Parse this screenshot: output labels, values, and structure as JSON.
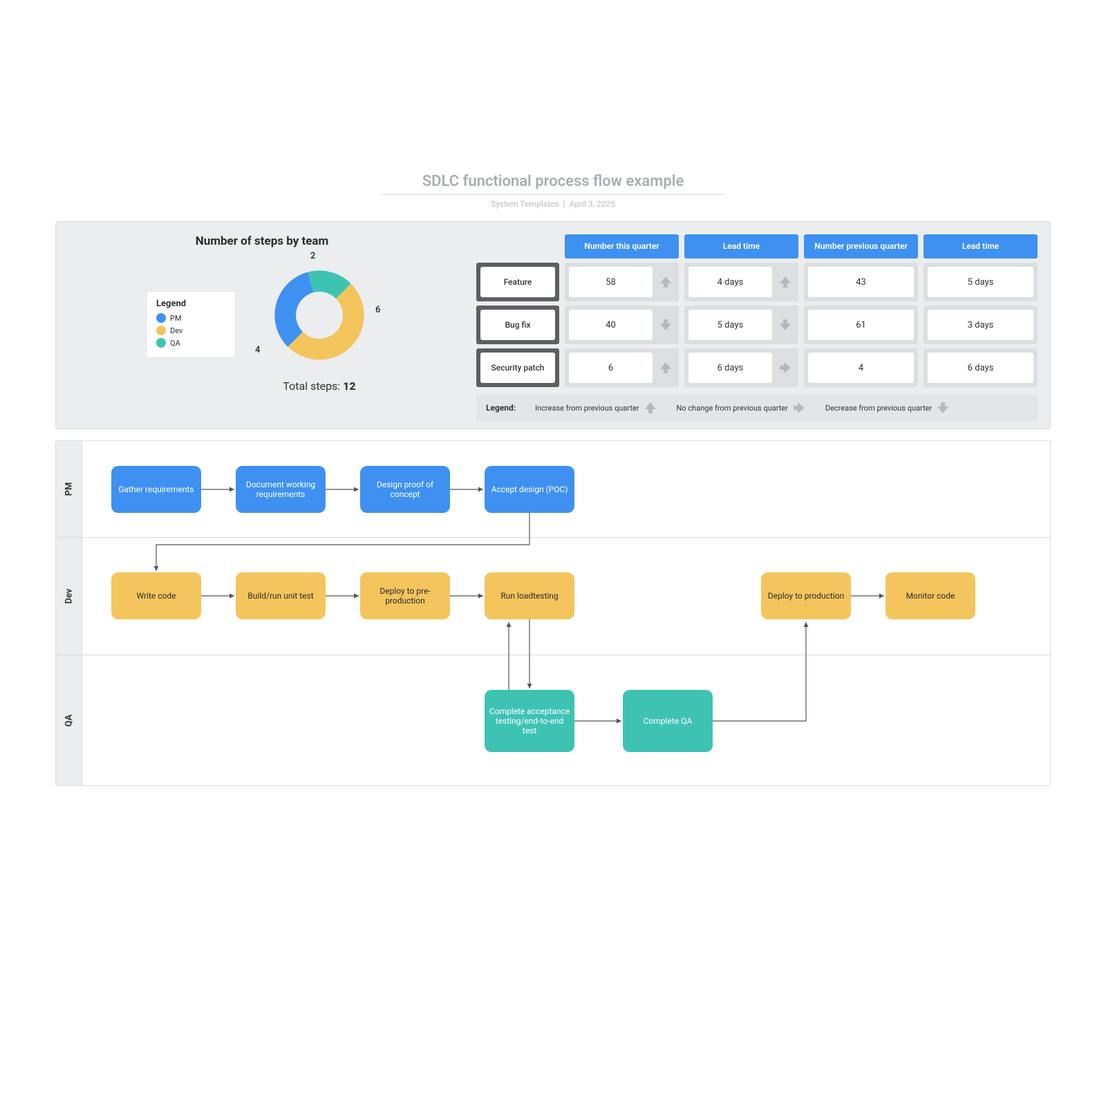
{
  "header": {
    "title": "SDLC functional process flow example",
    "source": "System Templates",
    "date": "April 3, 2025"
  },
  "chart_data": {
    "type": "pie",
    "title": "Number of steps by team",
    "categories": [
      "PM",
      "Dev",
      "QA"
    ],
    "values": [
      4,
      6,
      2
    ],
    "colors": [
      "#3e91f0",
      "#f4c55c",
      "#3ec3b3"
    ],
    "total_label": "Total steps:",
    "total_value": "12",
    "legend_title": "Legend"
  },
  "metrics": {
    "columns": [
      "Number this quarter",
      "Lead time",
      "Number previous quarter",
      "Lead time"
    ],
    "rows": [
      {
        "label": "Feature",
        "cells": [
          "58",
          "4 days",
          "43",
          "5 days"
        ],
        "trends": [
          "up",
          "up",
          null,
          null
        ]
      },
      {
        "label": "Bug fix",
        "cells": [
          "40",
          "5 days",
          "61",
          "3 days"
        ],
        "trends": [
          "down",
          "down",
          null,
          null
        ]
      },
      {
        "label": "Security patch",
        "cells": [
          "6",
          "6 days",
          "4",
          "6 days"
        ],
        "trends": [
          "up",
          "right",
          null,
          null
        ]
      }
    ],
    "legend": {
      "title": "Legend:",
      "items": [
        {
          "text": "Increase from previous quarter",
          "dir": "up"
        },
        {
          "text": "No change from previous quarter",
          "dir": "right"
        },
        {
          "text": "Decrease from previous quarter",
          "dir": "down"
        }
      ]
    }
  },
  "swim": {
    "lanes": [
      "PM",
      "Dev",
      "QA"
    ],
    "pm": [
      "Gather requirements",
      "Document working requirements",
      "Design proof of concept",
      "Accept design (POC)"
    ],
    "dev": [
      "Write code",
      "Build/run unit test",
      "Deploy to pre-production",
      "Run loadtesting",
      "Deploy to production",
      "Monitor code"
    ],
    "qa": [
      "Complete acceptance testing/end-to-end test",
      "Complete QA"
    ]
  }
}
